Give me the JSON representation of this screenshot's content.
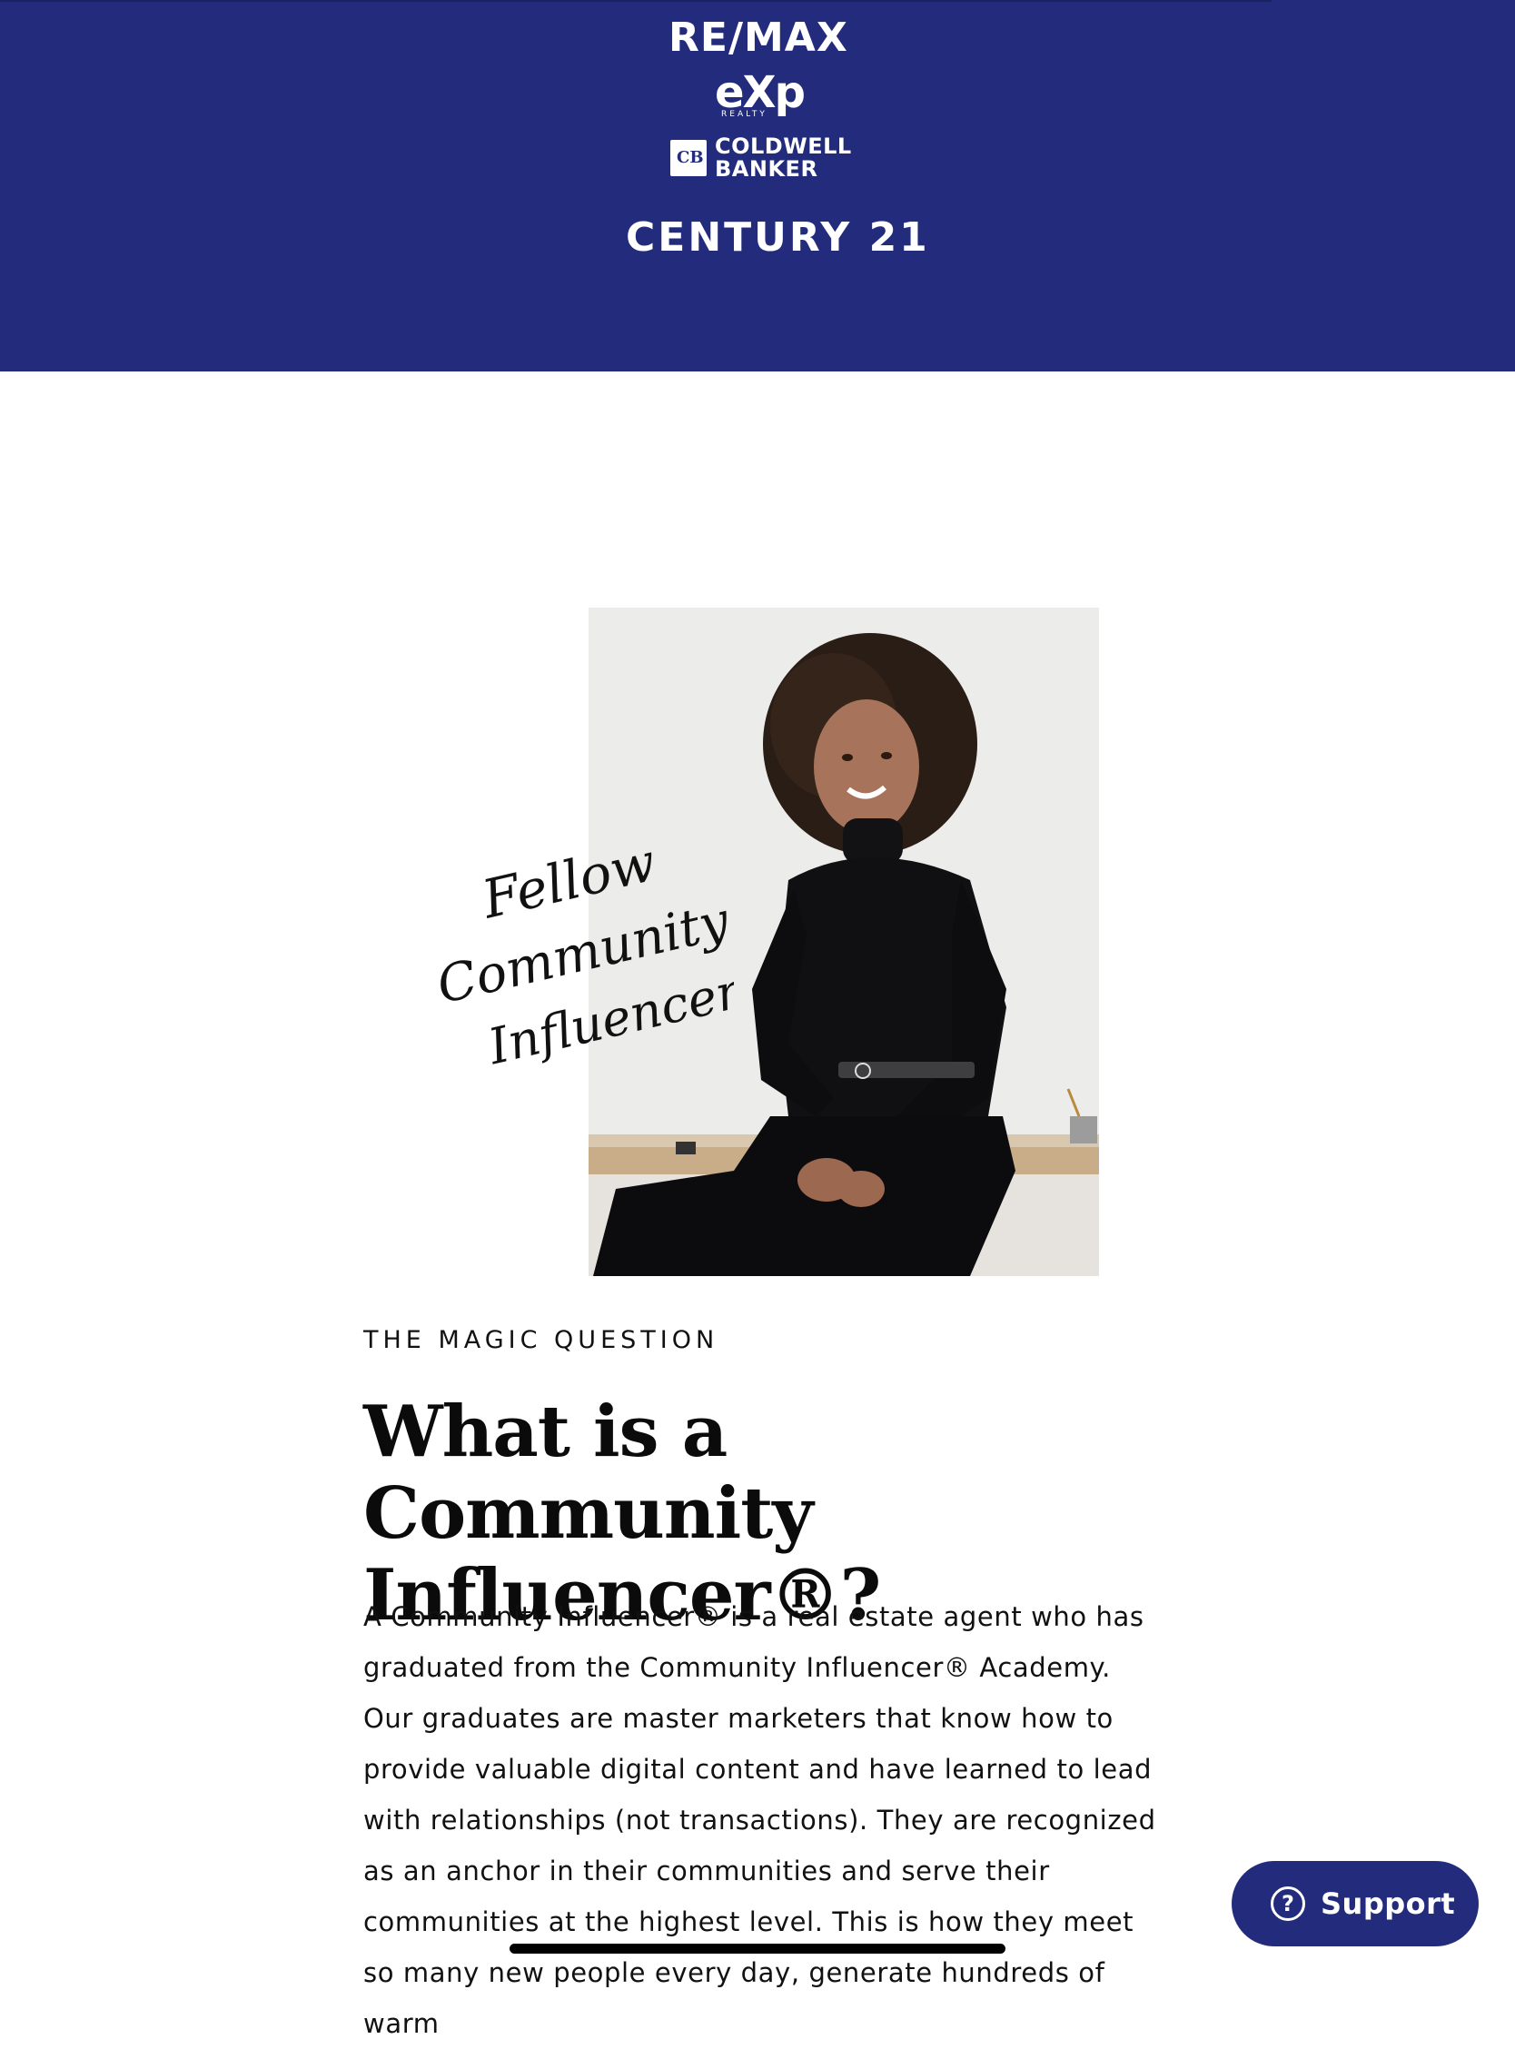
{
  "header": {
    "logos": {
      "remax": "RE/MAX",
      "exp": "eXp",
      "exp_sub": "REALTY",
      "coldwell_mark": "CB",
      "coldwell_line1": "COLDWELL",
      "coldwell_line2": "BANKER",
      "century21": "CENTURY 21"
    },
    "background_color": "#232c7c"
  },
  "hero": {
    "script_lines": [
      "Fellow",
      "Community",
      "Influencer"
    ]
  },
  "content": {
    "eyebrow": "THE MAGIC QUESTION",
    "headline_line1": "What is a Community",
    "headline_line2": "Influencer®?",
    "body": "A Community Influencer® is a real estate agent who has graduated from the Community Influencer® Academy. Our graduates are master marketers that know how to provide valuable digital content and have learned to lead with relationships (not transactions). They are recognized as an anchor in their communities and serve their communities at the highest level. This is how they meet so many new people every day, generate hundreds of warm"
  },
  "support": {
    "icon": "question-circle-icon",
    "label": "Support"
  },
  "colors": {
    "brand_navy": "#232c7c",
    "text": "#111111"
  }
}
